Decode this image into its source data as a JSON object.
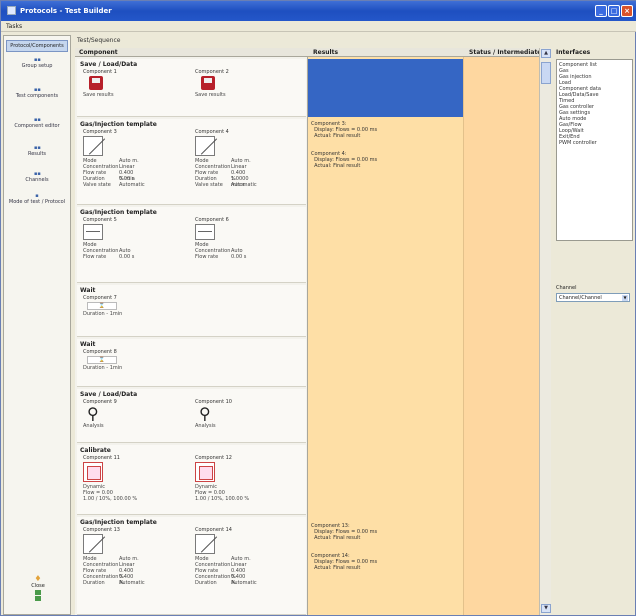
{
  "titlebar": {
    "title": "Protocols - Test Builder",
    "min": "_",
    "max": "□",
    "close": "×"
  },
  "menubar": {
    "item": "Tasks"
  },
  "sidebar": {
    "selected": "Protocol/Components",
    "items": [
      {
        "label": "Group setup",
        "icon": "▪▪"
      },
      {
        "label": "Test components",
        "icon": "▪▪"
      },
      {
        "label": "Component editor",
        "icon": "▪▪"
      },
      {
        "label": "Results",
        "icon": "▪▪"
      },
      {
        "label": "Channels",
        "icon": "▪▪"
      },
      {
        "label": "Mode of test / Protocol",
        "icon": "▪"
      }
    ],
    "bottom": {
      "label": "Close"
    }
  },
  "breadcrumb": "Test/Sequence",
  "columns": {
    "component": "Component",
    "results": "Results",
    "duration": "Status / Intermediate"
  },
  "groups": [
    {
      "title": "Save / Load/Data",
      "cards": [
        {
          "name": "Component 1",
          "kind": "disk",
          "lines": [
            "Save results"
          ]
        },
        {
          "name": "Component 2",
          "kind": "disk",
          "lines": [
            "Save results"
          ]
        }
      ]
    },
    {
      "title": "Gas/Injection template",
      "cards": [
        {
          "name": "Component 3",
          "kind": "diag",
          "lines": [
            "Mode",
            "Concentration",
            "Flow rate",
            "Duration",
            "Valve state"
          ],
          "vals": [
            "Auto m.",
            "Linear",
            "0.400 % min",
            "0.00 s",
            "Automatic"
          ]
        },
        {
          "name": "Component 4",
          "kind": "diag",
          "lines": [
            "Mode",
            "Concentration",
            "Flow rate",
            "Duration",
            "Valve state"
          ],
          "vals": [
            "Auto m.",
            "Linear",
            "0.400 %",
            "1.0000 min s",
            "Automatic"
          ]
        }
      ]
    },
    {
      "title": "Gas/Injection template",
      "cards": [
        {
          "name": "Component 5",
          "kind": "sq",
          "lines": [
            "Mode",
            "Concentration",
            "Flow rate"
          ],
          "vals": [
            "",
            "Auto",
            "0.00 s"
          ]
        },
        {
          "name": "Component 6",
          "kind": "sq",
          "lines": [
            "Mode",
            "Concentration",
            "Flow rate"
          ],
          "vals": [
            "",
            "Auto",
            "0.00 s"
          ]
        }
      ]
    },
    {
      "title": "Wait",
      "cards": [
        {
          "name": "Component 7",
          "kind": "pill",
          "lines": [
            "Duration - 1min"
          ]
        }
      ]
    },
    {
      "title": "Wait",
      "cards": [
        {
          "name": "Component 8",
          "kind": "pill",
          "lines": [
            "Duration - 1min"
          ]
        }
      ]
    },
    {
      "title": "Save / Load/Data",
      "cards": [
        {
          "name": "Component 9",
          "kind": "mag",
          "lines": [
            "Analysis"
          ]
        },
        {
          "name": "Component 10",
          "kind": "mag",
          "lines": [
            "Analysis"
          ]
        }
      ]
    },
    {
      "title": "Calibrate",
      "cards": [
        {
          "name": "Component 11",
          "kind": "red",
          "lines": [
            "Dynamic",
            "Flow = 0.00",
            "1.00 / 10%, 100.00 %"
          ]
        },
        {
          "name": "Component 12",
          "kind": "red",
          "lines": [
            "Dynamic",
            "Flow = 0.00",
            "1.00 / 10%, 100.00 %"
          ]
        }
      ]
    },
    {
      "title": "Gas/Injection template",
      "cards": [
        {
          "name": "Component 13",
          "kind": "diag",
          "lines": [
            "Mode",
            "Concentration",
            "Flow rate",
            "Concentration",
            "Duration"
          ],
          "vals": [
            "Auto m.",
            "Linear",
            "0.400 %",
            "0.400 %",
            "Automatic"
          ]
        },
        {
          "name": "Component 14",
          "kind": "diag",
          "lines": [
            "Mode",
            "Concentration",
            "Flow rate",
            "Concentration",
            "Duration"
          ],
          "vals": [
            "Auto m.",
            "Linear",
            "0.400 %",
            "0.400 %",
            "Automatic"
          ]
        }
      ]
    }
  ],
  "results": [
    {
      "lines": [
        "Component 3:",
        "  Display: Flows = 0.00 ms",
        "  Actual: Final result"
      ]
    },
    {
      "lines": [
        "Component 4:",
        "  Display: Flows = 0.00 ms",
        "  Actual: Final result"
      ]
    },
    {
      "lines": [
        "Component 13:",
        "  Display: Flows = 0.00 ms",
        "  Actual: Final result"
      ]
    },
    {
      "lines": [
        "Component 14:",
        "  Display: Flows = 0.00 ms",
        "  Actual: Final result"
      ]
    }
  ],
  "rightpanel": {
    "header": "Interfaces",
    "items": [
      "Component list",
      "Gas",
      "Gas injection",
      "Load",
      "Component data",
      "Load/Data/Save",
      "Timed",
      "Gas controller",
      "Gas settings",
      "Auto mode",
      "Gas/Flow",
      "Loop/Wait",
      "Exit/End",
      "PWM controller"
    ],
    "dropdown_label": "Channel",
    "dropdown_value": "Channel/Channel"
  },
  "colors": {
    "results_bg": "#fedfa6",
    "selected": "#3566c4",
    "titlebar": "#1e4fc0"
  }
}
